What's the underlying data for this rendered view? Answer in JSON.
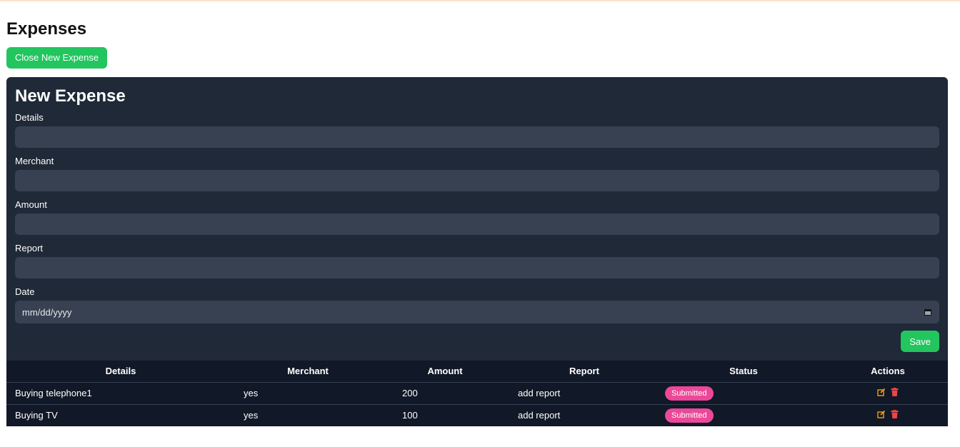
{
  "page": {
    "title": "Expenses"
  },
  "toolbar": {
    "toggle_label": "Close New Expense"
  },
  "form": {
    "title": "New Expense",
    "fields": {
      "details": {
        "label": "Details",
        "value": ""
      },
      "merchant": {
        "label": "Merchant",
        "value": ""
      },
      "amount": {
        "label": "Amount",
        "value": ""
      },
      "report": {
        "label": "Report",
        "value": ""
      },
      "date": {
        "label": "Date",
        "placeholder": "mm/dd/yyyy"
      }
    },
    "save_label": "Save"
  },
  "table": {
    "headers": [
      "Details",
      "Merchant",
      "Amount",
      "Report",
      "Status",
      "Actions"
    ],
    "rows": [
      {
        "details": "Buying telephone1",
        "merchant": "yes",
        "amount": "200",
        "report": "add report",
        "status": "Submitted"
      },
      {
        "details": "Buying TV",
        "merchant": "yes",
        "amount": "100",
        "report": "add report",
        "status": "Submitted"
      }
    ]
  },
  "colors": {
    "accent": "#22c55e",
    "panel": "#1f2937",
    "input": "#374151",
    "table": "#111827",
    "badge": "#ec4899",
    "edit": "#f59e0b",
    "delete": "#ef4444"
  },
  "icons": {
    "edit": "edit-icon",
    "delete": "trash-icon",
    "calendar": "calendar-icon"
  }
}
